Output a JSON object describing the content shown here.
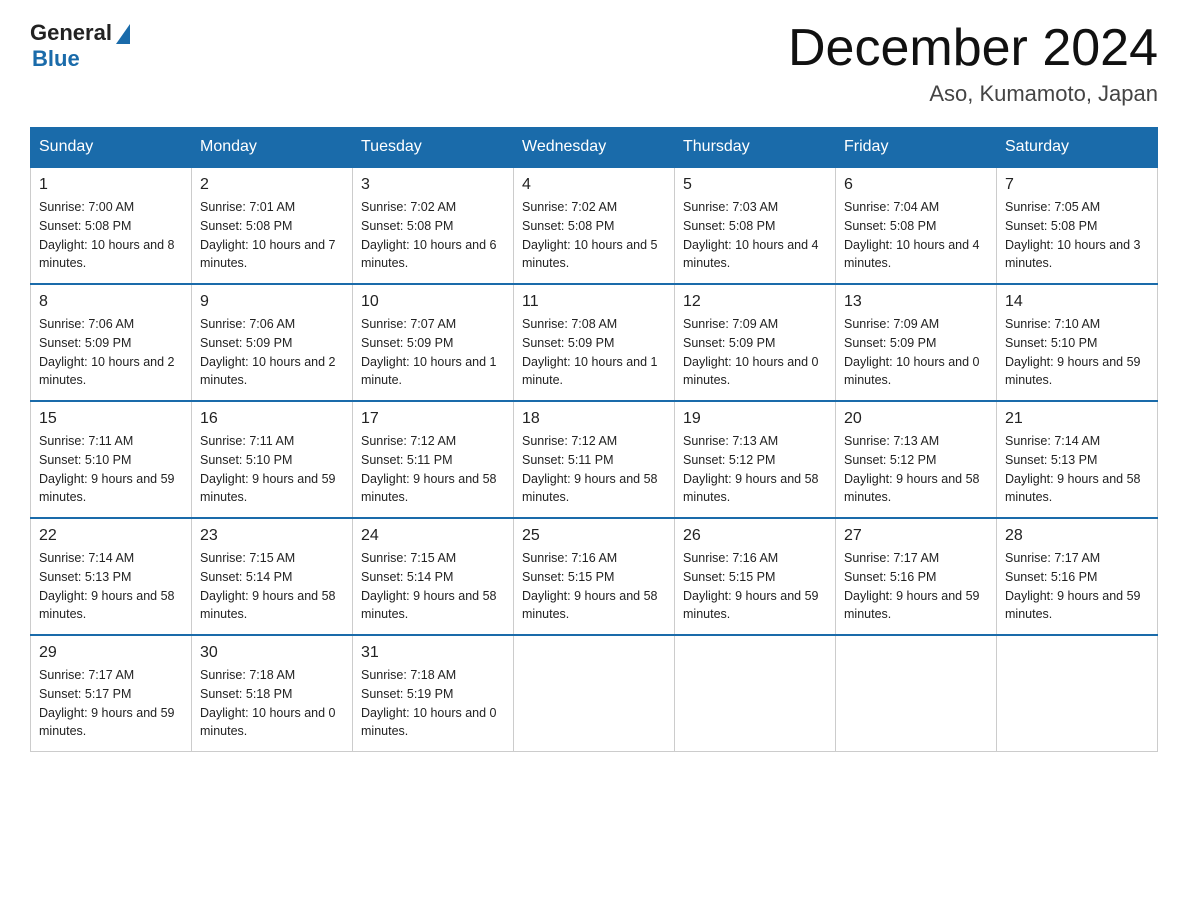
{
  "header": {
    "logo_general": "General",
    "logo_blue": "Blue",
    "month_title": "December 2024",
    "location": "Aso, Kumamoto, Japan"
  },
  "days_of_week": [
    "Sunday",
    "Monday",
    "Tuesday",
    "Wednesday",
    "Thursday",
    "Friday",
    "Saturday"
  ],
  "weeks": [
    [
      {
        "day": "1",
        "sunrise": "7:00 AM",
        "sunset": "5:08 PM",
        "daylight": "10 hours and 8 minutes."
      },
      {
        "day": "2",
        "sunrise": "7:01 AM",
        "sunset": "5:08 PM",
        "daylight": "10 hours and 7 minutes."
      },
      {
        "day": "3",
        "sunrise": "7:02 AM",
        "sunset": "5:08 PM",
        "daylight": "10 hours and 6 minutes."
      },
      {
        "day": "4",
        "sunrise": "7:02 AM",
        "sunset": "5:08 PM",
        "daylight": "10 hours and 5 minutes."
      },
      {
        "day": "5",
        "sunrise": "7:03 AM",
        "sunset": "5:08 PM",
        "daylight": "10 hours and 4 minutes."
      },
      {
        "day": "6",
        "sunrise": "7:04 AM",
        "sunset": "5:08 PM",
        "daylight": "10 hours and 4 minutes."
      },
      {
        "day": "7",
        "sunrise": "7:05 AM",
        "sunset": "5:08 PM",
        "daylight": "10 hours and 3 minutes."
      }
    ],
    [
      {
        "day": "8",
        "sunrise": "7:06 AM",
        "sunset": "5:09 PM",
        "daylight": "10 hours and 2 minutes."
      },
      {
        "day": "9",
        "sunrise": "7:06 AM",
        "sunset": "5:09 PM",
        "daylight": "10 hours and 2 minutes."
      },
      {
        "day": "10",
        "sunrise": "7:07 AM",
        "sunset": "5:09 PM",
        "daylight": "10 hours and 1 minute."
      },
      {
        "day": "11",
        "sunrise": "7:08 AM",
        "sunset": "5:09 PM",
        "daylight": "10 hours and 1 minute."
      },
      {
        "day": "12",
        "sunrise": "7:09 AM",
        "sunset": "5:09 PM",
        "daylight": "10 hours and 0 minutes."
      },
      {
        "day": "13",
        "sunrise": "7:09 AM",
        "sunset": "5:09 PM",
        "daylight": "10 hours and 0 minutes."
      },
      {
        "day": "14",
        "sunrise": "7:10 AM",
        "sunset": "5:10 PM",
        "daylight": "9 hours and 59 minutes."
      }
    ],
    [
      {
        "day": "15",
        "sunrise": "7:11 AM",
        "sunset": "5:10 PM",
        "daylight": "9 hours and 59 minutes."
      },
      {
        "day": "16",
        "sunrise": "7:11 AM",
        "sunset": "5:10 PM",
        "daylight": "9 hours and 59 minutes."
      },
      {
        "day": "17",
        "sunrise": "7:12 AM",
        "sunset": "5:11 PM",
        "daylight": "9 hours and 58 minutes."
      },
      {
        "day": "18",
        "sunrise": "7:12 AM",
        "sunset": "5:11 PM",
        "daylight": "9 hours and 58 minutes."
      },
      {
        "day": "19",
        "sunrise": "7:13 AM",
        "sunset": "5:12 PM",
        "daylight": "9 hours and 58 minutes."
      },
      {
        "day": "20",
        "sunrise": "7:13 AM",
        "sunset": "5:12 PM",
        "daylight": "9 hours and 58 minutes."
      },
      {
        "day": "21",
        "sunrise": "7:14 AM",
        "sunset": "5:13 PM",
        "daylight": "9 hours and 58 minutes."
      }
    ],
    [
      {
        "day": "22",
        "sunrise": "7:14 AM",
        "sunset": "5:13 PM",
        "daylight": "9 hours and 58 minutes."
      },
      {
        "day": "23",
        "sunrise": "7:15 AM",
        "sunset": "5:14 PM",
        "daylight": "9 hours and 58 minutes."
      },
      {
        "day": "24",
        "sunrise": "7:15 AM",
        "sunset": "5:14 PM",
        "daylight": "9 hours and 58 minutes."
      },
      {
        "day": "25",
        "sunrise": "7:16 AM",
        "sunset": "5:15 PM",
        "daylight": "9 hours and 58 minutes."
      },
      {
        "day": "26",
        "sunrise": "7:16 AM",
        "sunset": "5:15 PM",
        "daylight": "9 hours and 59 minutes."
      },
      {
        "day": "27",
        "sunrise": "7:17 AM",
        "sunset": "5:16 PM",
        "daylight": "9 hours and 59 minutes."
      },
      {
        "day": "28",
        "sunrise": "7:17 AM",
        "sunset": "5:16 PM",
        "daylight": "9 hours and 59 minutes."
      }
    ],
    [
      {
        "day": "29",
        "sunrise": "7:17 AM",
        "sunset": "5:17 PM",
        "daylight": "9 hours and 59 minutes."
      },
      {
        "day": "30",
        "sunrise": "7:18 AM",
        "sunset": "5:18 PM",
        "daylight": "10 hours and 0 minutes."
      },
      {
        "day": "31",
        "sunrise": "7:18 AM",
        "sunset": "5:19 PM",
        "daylight": "10 hours and 0 minutes."
      },
      null,
      null,
      null,
      null
    ]
  ],
  "labels": {
    "sunrise": "Sunrise:",
    "sunset": "Sunset:",
    "daylight": "Daylight:"
  }
}
